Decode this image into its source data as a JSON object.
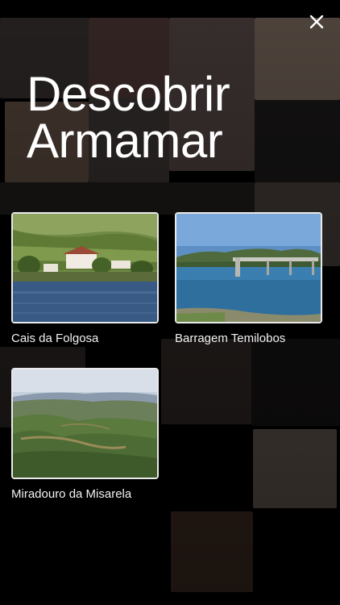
{
  "page": {
    "title_line1": "Descobrir",
    "title_line2": "Armamar"
  },
  "close_icon": "close-icon",
  "places": [
    {
      "name": "Cais da Folgosa",
      "image": "river-village-photo"
    },
    {
      "name": "Barragem Temilobos",
      "image": "dam-lake-photo"
    },
    {
      "name": "Miradouro da Misarela",
      "image": "valley-viewpoint-photo"
    }
  ]
}
